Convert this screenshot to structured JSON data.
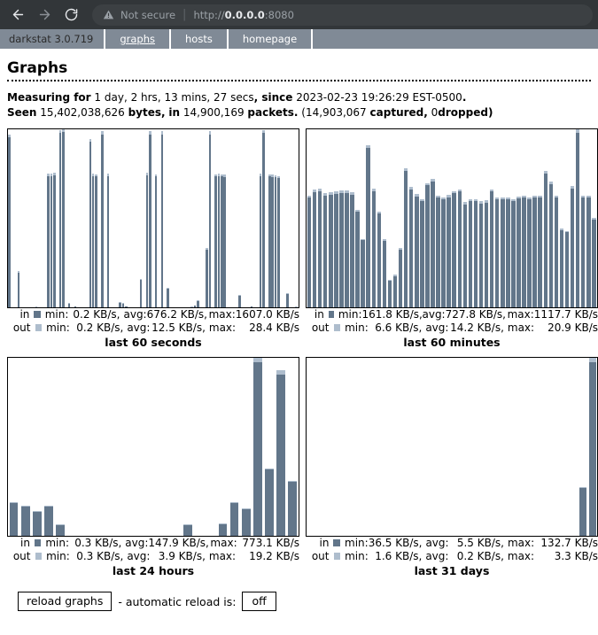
{
  "browser": {
    "back_icon": "arrow-left-icon",
    "forward_icon": "arrow-right-icon",
    "reload_icon": "reload-icon",
    "security_icon": "warning-triangle-icon",
    "security_label": "Not secure",
    "separator": "|",
    "url_scheme": "http://",
    "url_host": "0.0.0.0",
    "url_port": ":8080"
  },
  "nav": {
    "brand": "darkstat 3.0.719",
    "links": [
      {
        "label": "graphs",
        "active": true
      },
      {
        "label": "hosts",
        "active": false
      },
      {
        "label": "homepage",
        "active": false
      }
    ]
  },
  "page": {
    "title": "Graphs",
    "measuring_label": "Measuring for",
    "measuring_value": "1 day, 2 hrs, 13 mins, 27 secs",
    "since_label": "since",
    "since_value": "2023-02-23 19:26:29 EST-0500",
    "seen_label": "Seen",
    "bytes_value": "15,402,038,626",
    "bytes_label": "bytes,",
    "in_label": "in",
    "packets_value": "14,900,169",
    "packets_label": "packets.",
    "captured_open": "(",
    "captured_value": "14,903,067",
    "captured_label": "captured,",
    "dropped_value": "0",
    "dropped_label": "dropped)"
  },
  "colors": {
    "in": "#62768a",
    "out": "#aebdcd",
    "nav_bg": "#808a96",
    "chrome_bg": "#323639"
  },
  "labels": {
    "min": "min:",
    "avg": "avg:",
    "max": "max:",
    "unit": "KB/s",
    "dir_in": "in",
    "dir_out": "out"
  },
  "controls": {
    "reload_button": "reload graphs",
    "auto_text": "- automatic reload is:",
    "auto_state": "off"
  },
  "chart_data": [
    {
      "type": "bar",
      "title": "last 60 seconds",
      "ylabel": "KB/s",
      "stacked": true,
      "legend_position": "below",
      "grid": false,
      "series": [
        {
          "name": "in",
          "color": "#62768a",
          "min": "0.2 KB/s",
          "avg": "676.2 KB/s",
          "max": "1607.0 KB/s",
          "values": [
            1560,
            0,
            0,
            320,
            0,
            0,
            0,
            0,
            0,
            4,
            0,
            0,
            0,
            1205,
            1208,
            1215,
            0,
            1600,
            1607,
            0,
            35,
            0,
            8,
            0,
            0,
            0,
            0,
            1520,
            1205,
            1200,
            0,
            1590,
            0,
            1205,
            0,
            0,
            0,
            40,
            30,
            6,
            0,
            0,
            0,
            0,
            250,
            0,
            1210,
            1590,
            0,
            1200,
            0,
            1590,
            0,
            170,
            0,
            0,
            0,
            0,
            0,
            0,
            0,
            4,
            14,
            60,
            0,
            0,
            530,
            1590,
            0,
            1200,
            1205,
            1200,
            1195,
            0,
            0,
            0,
            0,
            105,
            0,
            0,
            0,
            5,
            0,
            0,
            1205,
            1600,
            0,
            1200,
            1195,
            1192,
            1185,
            0,
            0,
            120,
            0,
            0,
            3
          ]
        },
        {
          "name": "out",
          "color": "#aebdcd",
          "min": "0.2 KB/s",
          "avg": "12.5 KB/s",
          "max": "28.4 KB/s",
          "values": [
            28,
            0,
            0,
            10,
            0,
            0,
            0,
            0,
            0,
            2,
            0,
            0,
            0,
            22,
            24,
            25,
            0,
            27,
            28,
            0,
            8,
            0,
            3,
            0,
            0,
            0,
            0,
            26,
            22,
            22,
            0,
            27,
            0,
            22,
            0,
            0,
            0,
            10,
            9,
            3,
            0,
            0,
            0,
            0,
            9,
            0,
            23,
            27,
            0,
            22,
            0,
            27,
            0,
            8,
            0,
            0,
            0,
            0,
            0,
            0,
            0,
            2,
            5,
            8,
            0,
            0,
            12,
            27,
            0,
            22,
            23,
            22,
            22,
            0,
            0,
            0,
            0,
            6,
            0,
            0,
            0,
            2,
            0,
            0,
            22,
            28,
            0,
            22,
            22,
            22,
            22,
            0,
            0,
            7,
            0,
            0,
            2
          ]
        }
      ]
    },
    {
      "type": "bar",
      "title": "last 60 minutes",
      "ylabel": "KB/s",
      "stacked": true,
      "legend_position": "below",
      "grid": false,
      "series": [
        {
          "name": "in",
          "color": "#62768a",
          "min": "161.8 KB/s",
          "avg": "727.8 KB/s",
          "max": "1117.7 KB/s",
          "values": [
            700,
            735,
            740,
            715,
            720,
            725,
            730,
            730,
            720,
            610,
            430,
            1020,
            745,
            600,
            425,
            170,
            200,
            370,
            870,
            755,
            710,
            680,
            780,
            805,
            700,
            690,
            705,
            730,
            740,
            660,
            680,
            680,
            665,
            670,
            740,
            690,
            690,
            690,
            680,
            695,
            700,
            690,
            700,
            700,
            855,
            790,
            700,
            495,
            480,
            760,
            1118,
            700,
            700,
            560
          ]
        },
        {
          "name": "out",
          "color": "#aebdcd",
          "min": "6.6 KB/s",
          "avg": "14.2 KB/s",
          "max": "20.9 KB/s",
          "values": [
            14,
            16,
            17,
            14,
            15,
            15,
            16,
            16,
            14,
            12,
            9,
            18,
            15,
            12,
            9,
            7,
            8,
            9,
            17,
            15,
            14,
            13,
            16,
            17,
            14,
            14,
            14,
            15,
            15,
            13,
            14,
            14,
            13,
            13,
            15,
            14,
            14,
            14,
            14,
            14,
            14,
            14,
            14,
            14,
            19,
            17,
            14,
            10,
            10,
            15,
            21,
            14,
            14,
            11
          ]
        }
      ]
    },
    {
      "type": "bar",
      "title": "last 24 hours",
      "ylabel": "KB/s",
      "stacked": true,
      "legend_position": "below",
      "grid": false,
      "series": [
        {
          "name": "in",
          "color": "#62768a",
          "min": "0.3 KB/s",
          "avg": "147.9 KB/s",
          "max": "773.1 KB/s",
          "values": [
            147,
            132,
            105,
            130,
            48,
            0,
            0,
            0,
            0,
            0,
            0,
            0,
            0,
            0,
            0,
            48,
            0,
            0,
            52,
            145,
            120,
            773,
            295,
            718,
            240
          ]
        },
        {
          "name": "out",
          "color": "#aebdcd",
          "min": "0.3 KB/s",
          "avg": "3.9 KB/s",
          "max": "19.2 KB/s",
          "values": [
            4,
            4,
            4,
            4,
            2,
            0,
            0,
            0,
            0,
            0,
            0,
            0,
            0,
            0,
            0,
            2,
            0,
            0,
            2,
            5,
            3,
            19,
            6,
            17,
            6
          ]
        }
      ]
    },
    {
      "type": "bar",
      "title": "last 31 days",
      "ylabel": "KB/s",
      "stacked": true,
      "legend_position": "below",
      "grid": false,
      "series": [
        {
          "name": "in",
          "color": "#62768a",
          "min": "36.5 KB/s",
          "avg": "5.5 KB/s",
          "max": "132.7 KB/s",
          "values": [
            0,
            0,
            0,
            0,
            0,
            0,
            0,
            0,
            0,
            0,
            0,
            0,
            0,
            0,
            0,
            0,
            0,
            0,
            0,
            0,
            0,
            0,
            0,
            0,
            0,
            0,
            0,
            0,
            0,
            36.5,
            132.7
          ]
        },
        {
          "name": "out",
          "color": "#aebdcd",
          "min": "1.6 KB/s",
          "avg": "0.2 KB/s",
          "max": "3.3 KB/s",
          "values": [
            0,
            0,
            0,
            0,
            0,
            0,
            0,
            0,
            0,
            0,
            0,
            0,
            0,
            0,
            0,
            0,
            0,
            0,
            0,
            0,
            0,
            0,
            0,
            0,
            0,
            0,
            0,
            0,
            0,
            0.5,
            3.3
          ]
        }
      ]
    }
  ]
}
